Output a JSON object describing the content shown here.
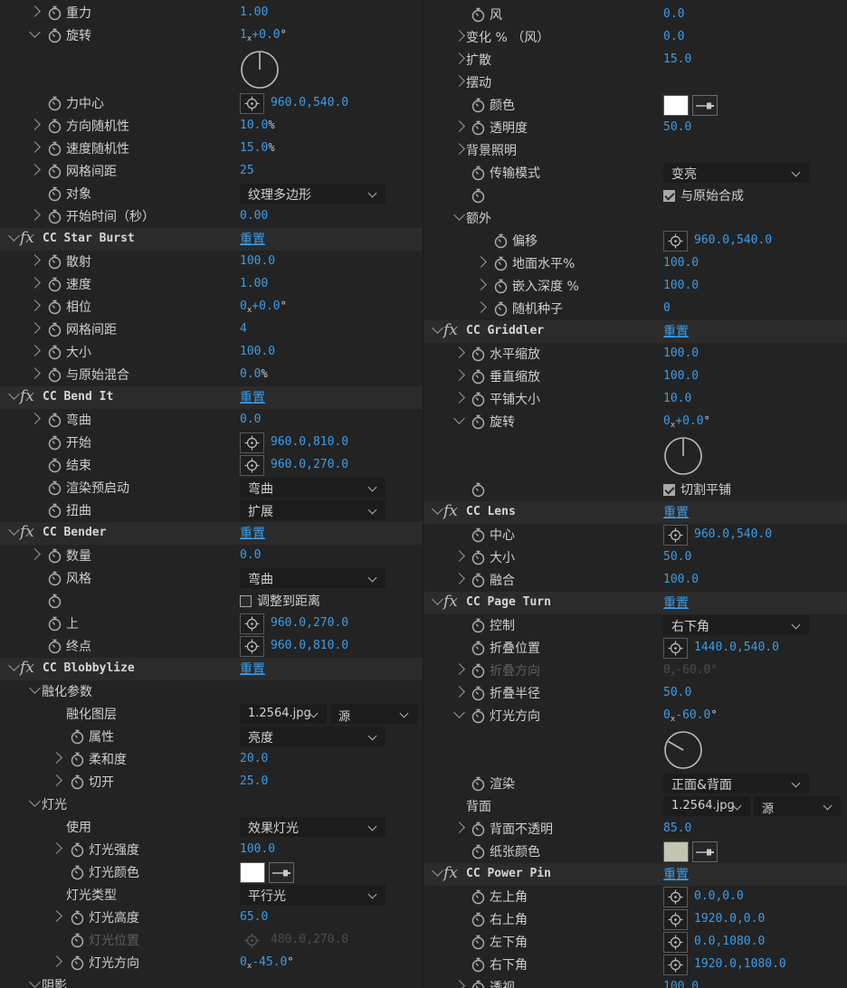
{
  "left": [
    {
      "kind": "prop",
      "indent": 1,
      "tw": "closed",
      "sw": true,
      "label": "重力",
      "val": "1.00"
    },
    {
      "kind": "prop",
      "indent": 1,
      "tw": "open",
      "sw": true,
      "label": "旋转",
      "ang": {
        "rev": "1",
        "deg": "+0.0"
      }
    },
    {
      "kind": "dial",
      "angle": 0
    },
    {
      "kind": "prop",
      "indent": 1,
      "sw": true,
      "label": "力中心",
      "point": "960.0,540.0"
    },
    {
      "kind": "prop",
      "indent": 1,
      "tw": "closed",
      "sw": true,
      "label": "方向随机性",
      "val": "10.0",
      "unit": "%"
    },
    {
      "kind": "prop",
      "indent": 1,
      "tw": "closed",
      "sw": true,
      "label": "速度随机性",
      "val": "15.0",
      "unit": "%"
    },
    {
      "kind": "prop",
      "indent": 1,
      "tw": "closed",
      "sw": true,
      "label": "网格间距",
      "val": "25"
    },
    {
      "kind": "prop",
      "indent": 1,
      "sw": true,
      "label": "对象",
      "dd": "纹理多边形"
    },
    {
      "kind": "prop",
      "indent": 1,
      "tw": "closed",
      "sw": true,
      "label": "开始时间（秒）",
      "val": "0.00"
    },
    {
      "kind": "fx",
      "name": "CC Star Burst",
      "reset": "重置"
    },
    {
      "kind": "prop",
      "indent": 1,
      "tw": "closed",
      "sw": true,
      "label": "散射",
      "val": "100.0"
    },
    {
      "kind": "prop",
      "indent": 1,
      "tw": "closed",
      "sw": true,
      "label": "速度",
      "val": "1.00"
    },
    {
      "kind": "prop",
      "indent": 1,
      "tw": "closed",
      "sw": true,
      "label": "相位",
      "ang": {
        "rev": "0",
        "deg": "+0.0"
      }
    },
    {
      "kind": "prop",
      "indent": 1,
      "tw": "closed",
      "sw": true,
      "label": "网格间距",
      "val": "4"
    },
    {
      "kind": "prop",
      "indent": 1,
      "tw": "closed",
      "sw": true,
      "label": "大小",
      "val": "100.0"
    },
    {
      "kind": "prop",
      "indent": 1,
      "tw": "closed",
      "sw": true,
      "label": "与原始混合",
      "val": "0.0",
      "unit": "%"
    },
    {
      "kind": "fx",
      "name": "CC Bend It",
      "reset": "重置"
    },
    {
      "kind": "prop",
      "indent": 1,
      "tw": "closed",
      "sw": true,
      "label": "弯曲",
      "val": "0.0"
    },
    {
      "kind": "prop",
      "indent": 1,
      "sw": true,
      "label": "开始",
      "point": "960.0,810.0"
    },
    {
      "kind": "prop",
      "indent": 1,
      "sw": true,
      "label": "结束",
      "point": "960.0,270.0"
    },
    {
      "kind": "prop",
      "indent": 1,
      "sw": true,
      "label": "渲染预启动",
      "dd": "弯曲"
    },
    {
      "kind": "prop",
      "indent": 1,
      "sw": true,
      "label": "扭曲",
      "dd": "扩展"
    },
    {
      "kind": "fx",
      "name": "CC Bender",
      "reset": "重置"
    },
    {
      "kind": "prop",
      "indent": 1,
      "tw": "closed",
      "sw": true,
      "label": "数量",
      "val": "0.0"
    },
    {
      "kind": "prop",
      "indent": 1,
      "sw": true,
      "label": "风格",
      "dd": "弯曲"
    },
    {
      "kind": "prop",
      "indent": 1,
      "sw": true,
      "label": "",
      "cb": {
        "on": false,
        "label": "调整到距离"
      }
    },
    {
      "kind": "prop",
      "indent": 1,
      "sw": true,
      "label": "上",
      "point": "960.0,270.0"
    },
    {
      "kind": "prop",
      "indent": 1,
      "sw": true,
      "label": "终点",
      "point": "960.0,810.0"
    },
    {
      "kind": "fx",
      "name": "CC Blobbylize",
      "reset": "重置"
    },
    {
      "kind": "group",
      "indent": 1,
      "tw": "open",
      "label": "融化参数"
    },
    {
      "kind": "prop",
      "indent": 2,
      "label": "融化图层",
      "dd2": [
        "1.2564.jpg",
        "源"
      ]
    },
    {
      "kind": "prop",
      "indent": 2,
      "sw": true,
      "label": "属性",
      "dd": "亮度"
    },
    {
      "kind": "prop",
      "indent": 2,
      "tw": "closed",
      "sw": true,
      "label": "柔和度",
      "val": "20.0"
    },
    {
      "kind": "prop",
      "indent": 2,
      "tw": "closed",
      "sw": true,
      "label": "切开",
      "val": "25.0"
    },
    {
      "kind": "group",
      "indent": 1,
      "tw": "open",
      "label": "灯光"
    },
    {
      "kind": "prop",
      "indent": 2,
      "label": "使用",
      "dd": "效果灯光"
    },
    {
      "kind": "prop",
      "indent": 2,
      "tw": "closed",
      "sw": true,
      "label": "灯光强度",
      "val": "100.0"
    },
    {
      "kind": "prop",
      "indent": 2,
      "sw": true,
      "label": "灯光颜色",
      "color": "#ffffff"
    },
    {
      "kind": "prop",
      "indent": 2,
      "label": "灯光类型",
      "dd": "平行光"
    },
    {
      "kind": "prop",
      "indent": 2,
      "tw": "closed",
      "sw": true,
      "label": "灯光高度",
      "val": "65.0"
    },
    {
      "kind": "prop",
      "indent": 2,
      "sw": true,
      "label": "灯光位置",
      "point": "480.0,270.0",
      "disabled": true
    },
    {
      "kind": "prop",
      "indent": 2,
      "tw": "closed",
      "sw": true,
      "label": "灯光方向",
      "ang": {
        "rev": "0",
        "deg": "-45.0"
      }
    },
    {
      "kind": "group",
      "indent": 1,
      "tw": "open",
      "label": "阴影"
    }
  ],
  "right": [
    {
      "kind": "prop",
      "indent": 1,
      "sw": true,
      "label": "风",
      "val": "0.0"
    },
    {
      "kind": "prop",
      "indent": 1,
      "tw": "closed",
      "label": "变化 % （风）",
      "val": "0.0"
    },
    {
      "kind": "prop",
      "indent": 1,
      "tw": "closed",
      "label": "扩散",
      "val": "15.0"
    },
    {
      "kind": "prop",
      "indent": 1,
      "tw": "closed",
      "label": "摆动"
    },
    {
      "kind": "prop",
      "indent": 1,
      "sw": true,
      "label": "颜色",
      "color": "#ffffff"
    },
    {
      "kind": "prop",
      "indent": 1,
      "tw": "closed",
      "sw": true,
      "label": "透明度",
      "val": "50.0"
    },
    {
      "kind": "prop",
      "indent": 1,
      "tw": "closed",
      "label": "背景照明"
    },
    {
      "kind": "prop",
      "indent": 1,
      "sw": true,
      "label": "传输模式",
      "dd": "变亮"
    },
    {
      "kind": "prop",
      "indent": 1,
      "sw": true,
      "label": "",
      "cb": {
        "on": true,
        "label": "与原始合成"
      }
    },
    {
      "kind": "group",
      "indent": 1,
      "tw": "open",
      "label": "额外"
    },
    {
      "kind": "prop",
      "indent": 2,
      "sw": true,
      "label": "偏移",
      "point": "960.0,540.0"
    },
    {
      "kind": "prop",
      "indent": 2,
      "tw": "closed",
      "sw": true,
      "label": "地面水平%",
      "val": "100.0"
    },
    {
      "kind": "prop",
      "indent": 2,
      "tw": "closed",
      "sw": true,
      "label": "嵌入深度 %",
      "val": "100.0"
    },
    {
      "kind": "prop",
      "indent": 2,
      "tw": "closed",
      "sw": true,
      "label": "随机种子",
      "val": "0"
    },
    {
      "kind": "fx",
      "name": "CC Griddler",
      "reset": "重置"
    },
    {
      "kind": "prop",
      "indent": 1,
      "tw": "closed",
      "sw": true,
      "label": "水平缩放",
      "val": "100.0"
    },
    {
      "kind": "prop",
      "indent": 1,
      "tw": "closed",
      "sw": true,
      "label": "垂直缩放",
      "val": "100.0"
    },
    {
      "kind": "prop",
      "indent": 1,
      "tw": "closed",
      "sw": true,
      "label": "平铺大小",
      "val": "10.0"
    },
    {
      "kind": "prop",
      "indent": 1,
      "tw": "open",
      "sw": true,
      "label": "旋转",
      "ang": {
        "rev": "0",
        "deg": "+0.0"
      }
    },
    {
      "kind": "dial",
      "angle": 0
    },
    {
      "kind": "prop",
      "indent": 1,
      "sw": true,
      "label": "",
      "cb": {
        "on": true,
        "label": "切割平铺"
      }
    },
    {
      "kind": "fx",
      "name": "CC Lens",
      "reset": "重置"
    },
    {
      "kind": "prop",
      "indent": 1,
      "sw": true,
      "label": "中心",
      "point": "960.0,540.0"
    },
    {
      "kind": "prop",
      "indent": 1,
      "tw": "closed",
      "sw": true,
      "label": "大小",
      "val": "50.0"
    },
    {
      "kind": "prop",
      "indent": 1,
      "tw": "closed",
      "sw": true,
      "label": "融合",
      "val": "100.0"
    },
    {
      "kind": "fx",
      "name": "CC Page Turn",
      "reset": "重置"
    },
    {
      "kind": "prop",
      "indent": 1,
      "sw": true,
      "label": "控制",
      "dd": "右下角"
    },
    {
      "kind": "prop",
      "indent": 1,
      "sw": true,
      "label": "折叠位置",
      "point": "1440.0,540.0"
    },
    {
      "kind": "prop",
      "indent": 1,
      "tw": "closed",
      "sw": true,
      "label": "折叠方向",
      "ang": {
        "rev": "0",
        "deg": "-60.0"
      },
      "disabled": true
    },
    {
      "kind": "prop",
      "indent": 1,
      "tw": "closed",
      "sw": true,
      "label": "折叠半径",
      "val": "50.0"
    },
    {
      "kind": "prop",
      "indent": 1,
      "tw": "open",
      "sw": true,
      "label": "灯光方向",
      "ang": {
        "rev": "0",
        "deg": "-60.0"
      }
    },
    {
      "kind": "dial",
      "angle": -60
    },
    {
      "kind": "prop",
      "indent": 1,
      "sw": true,
      "label": "渲染",
      "dd": "正面&背面"
    },
    {
      "kind": "prop",
      "indent": 1,
      "label": "背面",
      "dd2": [
        "1.2564.jpg",
        "源"
      ]
    },
    {
      "kind": "prop",
      "indent": 1,
      "tw": "closed",
      "sw": true,
      "label": "背面不透明",
      "val": "85.0"
    },
    {
      "kind": "prop",
      "indent": 1,
      "sw": true,
      "label": "纸张颜色",
      "color": "#c5c4b4"
    },
    {
      "kind": "fx",
      "name": "CC Power Pin",
      "reset": "重置"
    },
    {
      "kind": "prop",
      "indent": 1,
      "sw": true,
      "label": "左上角",
      "point": "0.0,0.0"
    },
    {
      "kind": "prop",
      "indent": 1,
      "sw": true,
      "label": "右上角",
      "point": "1920.0,0.0"
    },
    {
      "kind": "prop",
      "indent": 1,
      "sw": true,
      "label": "左下角",
      "point": "0.0,1080.0"
    },
    {
      "kind": "prop",
      "indent": 1,
      "sw": true,
      "label": "右下角",
      "point": "1920.0,1080.0"
    },
    {
      "kind": "prop",
      "indent": 1,
      "tw": "closed",
      "sw": true,
      "label": "透视",
      "val": "100.0"
    }
  ],
  "accent": "#3a9dea"
}
